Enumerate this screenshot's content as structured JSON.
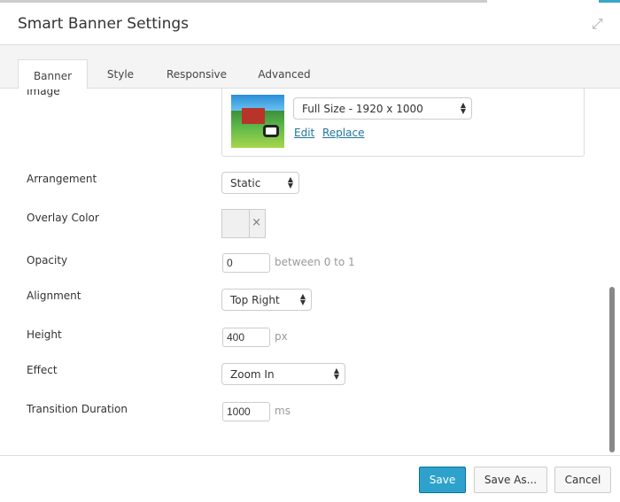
{
  "dialog": {
    "title": "Smart Banner Settings",
    "expand_icon": "expand-icon"
  },
  "tabs": [
    {
      "label": "Banner",
      "active": true
    },
    {
      "label": "Style"
    },
    {
      "label": "Responsive"
    },
    {
      "label": "Advanced"
    }
  ],
  "fields": {
    "image": {
      "label": "Image",
      "size_select": "Full Size - 1920 x 1000",
      "edit": "Edit",
      "replace": "Replace"
    },
    "arrangement": {
      "label": "Arrangement",
      "value": "Static"
    },
    "overlay_color": {
      "label": "Overlay Color",
      "clear": "×"
    },
    "opacity": {
      "label": "Opacity",
      "value": "0",
      "hint": "between 0 to 1"
    },
    "alignment": {
      "label": "Alignment",
      "value": "Top Right"
    },
    "height": {
      "label": "Height",
      "value": "400",
      "unit": "px"
    },
    "effect": {
      "label": "Effect",
      "value": "Zoom In"
    },
    "transition": {
      "label": "Transition Duration",
      "value": "1000",
      "unit": "ms"
    }
  },
  "footer": {
    "save": "Save",
    "save_as": "Save As...",
    "cancel": "Cancel"
  },
  "colors": {
    "primary": "#2ea2cc",
    "link": "#21759b"
  }
}
